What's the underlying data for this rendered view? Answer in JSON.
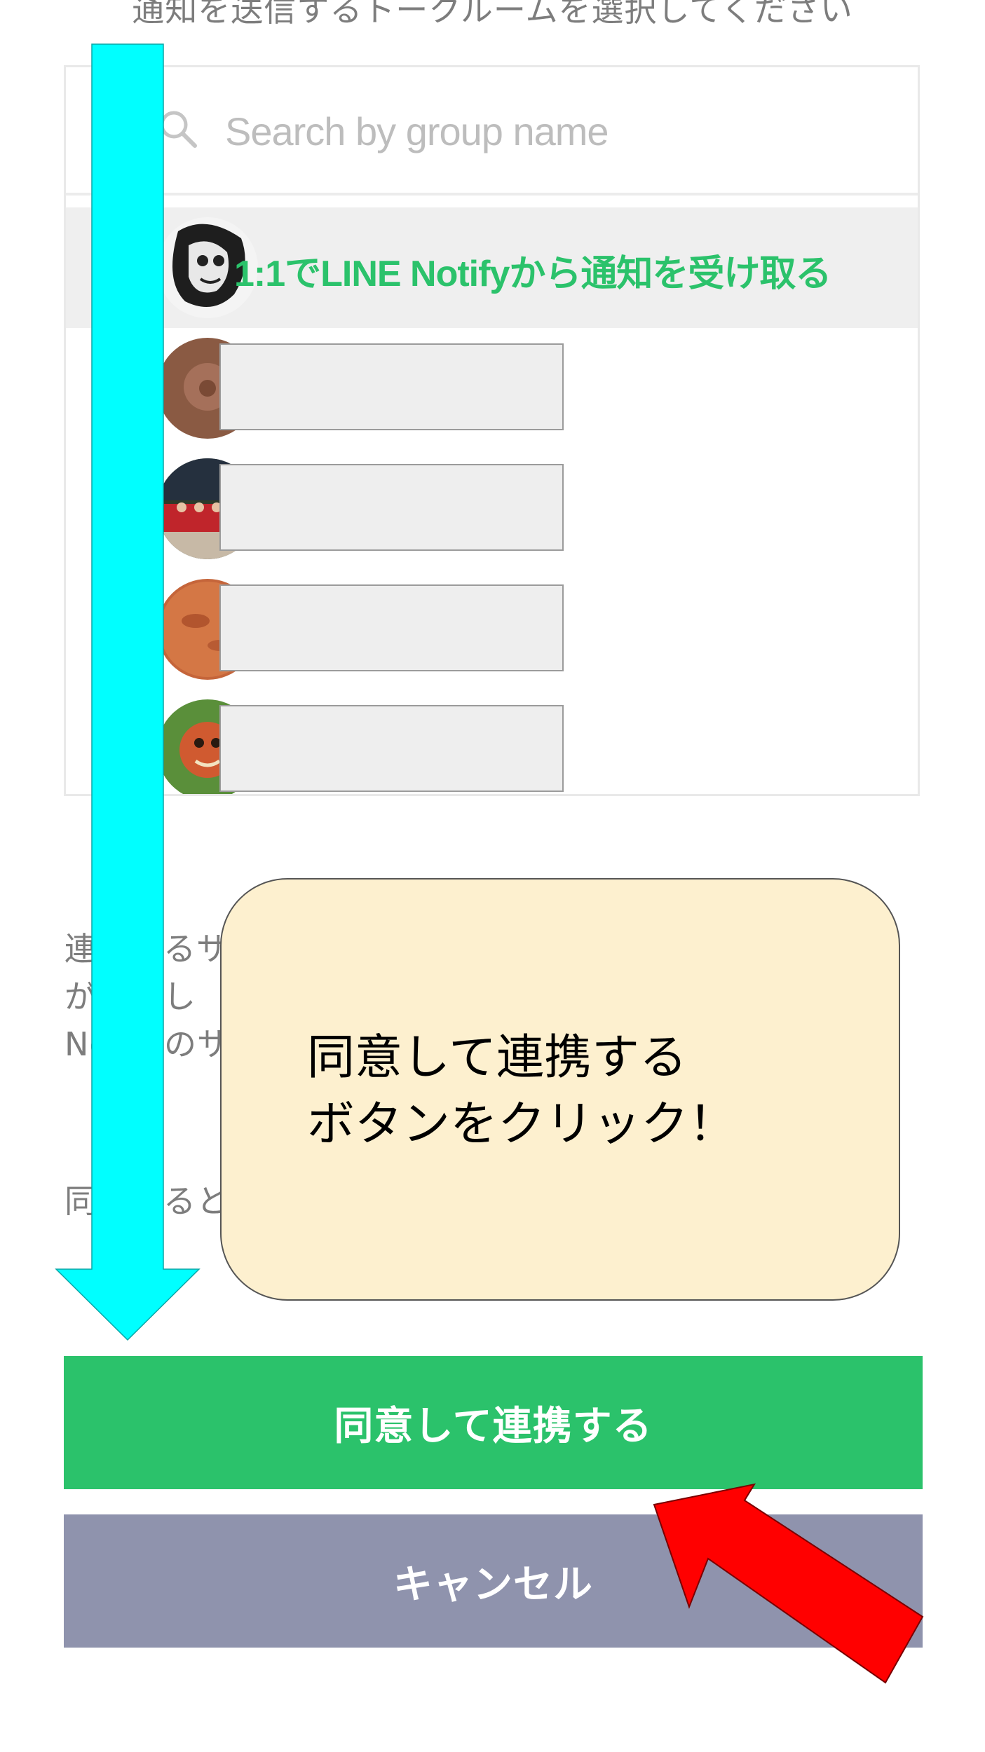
{
  "header": {
    "instruction": "通知を送信するトークルームを選択してください"
  },
  "search": {
    "placeholder": "Search by group name",
    "value": ""
  },
  "rooms": {
    "selected_label": "1:1でLINE Notifyから通知を受け取る"
  },
  "description": {
    "paragraph_1_lines": [
      "連携するサービスにトークルームの名前",
      "が連動し",
      "Notifyのサービスで利用規約などに同意し機能"
    ],
    "paragraph_2": "同意すると連携サービスに通知が送信され、友"
  },
  "callout": {
    "text": "同意して連携する\nボタンをクリック！"
  },
  "buttons": {
    "agree_label": "同意して連携する",
    "cancel_label": "キャンセル"
  },
  "colors": {
    "line_green": "#2bc26b",
    "cancel_gray": "#8f93ad",
    "callout_fill": "#fdf0cf",
    "cyan_arrow": "#00ffff",
    "red_arrow": "#ff0000"
  },
  "icons": {
    "search": "search-icon",
    "arrow_down": "cyan-down-arrow",
    "arrow_pointer": "red-pointer-arrow"
  }
}
